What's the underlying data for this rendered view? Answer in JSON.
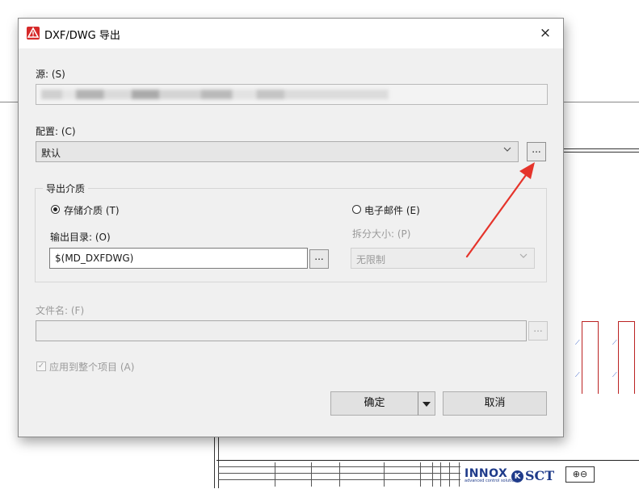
{
  "dialog": {
    "title": "DXF/DWG 导出",
    "close_glyph": "×"
  },
  "source": {
    "label": "源: (S)",
    "value": ""
  },
  "config": {
    "label": "配置: (C)",
    "value": "默认",
    "browse_label": "..."
  },
  "export_media": {
    "group_title": "导出介质",
    "storage_label": "存储介质 (T)",
    "storage_selected": true,
    "email_label": "电子邮件 (E)",
    "email_selected": false,
    "output_dir_label": "输出目录: (O)",
    "output_dir_value": "$(MD_DXFDWG)",
    "output_dir_browse": "...",
    "split_size_label": "拆分大小: (P)",
    "split_size_value": "无限制"
  },
  "filename": {
    "label": "文件名: (F)",
    "value": "",
    "browse_label": "..."
  },
  "apply_all": {
    "label": "应用到整个项目 (A)",
    "checked": true
  },
  "buttons": {
    "ok": "确定",
    "cancel": "取消"
  },
  "background": {
    "brand1": "INNOX",
    "brand1_sub": "advanced control solutions",
    "brand2": "SCT",
    "brand2_mark": "K",
    "symbol_box": "⊕⊖"
  },
  "colors": {
    "annotation_arrow": "#e5342b",
    "app_icon": "#d62a2a",
    "brand": "#1f3b8a",
    "wire": "#bb2222"
  },
  "icons": {
    "app": "warning-triangle-icon",
    "close": "close-icon",
    "dropdown": "chevron-down-icon",
    "split_arrow": "caret-down-icon"
  }
}
